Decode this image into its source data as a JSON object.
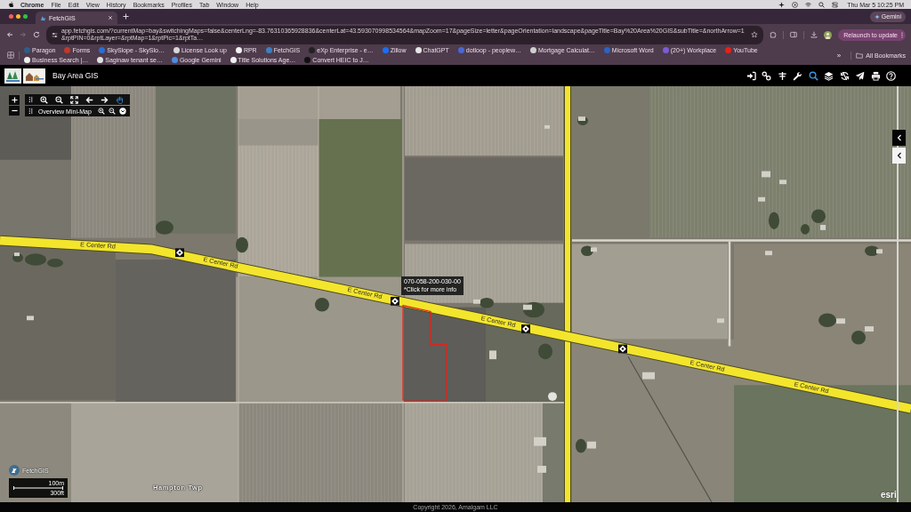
{
  "menu_bar": {
    "app": "Chrome",
    "menus": [
      "File",
      "Edit",
      "View",
      "History",
      "Bookmarks",
      "Profiles",
      "Tab",
      "Window",
      "Help"
    ],
    "clock": "Thu Mar 5 10:25 PM"
  },
  "browser": {
    "tabs": [
      {
        "title": "FetchGIS",
        "selected": true
      }
    ],
    "gemini_button": "Gemini",
    "nav": [
      {
        "kind": "back",
        "disabled": false
      },
      {
        "kind": "forward",
        "disabled": true
      },
      {
        "kind": "reload",
        "disabled": false
      }
    ],
    "url": "app.fetchgis.com/?currentMap=bay&switchingMaps=false&centerLng=-83.76310365928836&centerLat=43.593070998534564&mapZoom=17&pageSize=letter&pageOrientation=landscape&pageTitle=Bay%20Area%20GIS&subTitle=&northArrow=1&rptPIN=0&rptLayer=&rptMap=1&rptPic=1&rptTa…",
    "relaunch_button": "Relaunch to update",
    "bookmarks": [
      {
        "label": "Paragon",
        "color": "#2f5d8a"
      },
      {
        "label": "Forms",
        "color": "#c0392b"
      },
      {
        "label": "SkySlope - SkySlo…",
        "color": "#2a6fd1"
      },
      {
        "label": "License Look up",
        "color": "#d8d8d8"
      },
      {
        "label": "RPR",
        "color": "#f2f2f2"
      },
      {
        "label": "FetchGIS",
        "color": "#3d7fc1"
      },
      {
        "label": "eXp Enterprise - e…",
        "color": "#222222"
      },
      {
        "label": "Zillow",
        "color": "#1a6ff0"
      },
      {
        "label": "ChatGPT",
        "color": "#e6e6e6"
      },
      {
        "label": "dotloop - peoplew…",
        "color": "#4a67d6"
      },
      {
        "label": "Mortgage Calculat…",
        "color": "#cfcfcf"
      },
      {
        "label": "Microsoft Word",
        "color": "#2b63c7"
      },
      {
        "label": "(20+) Workplace",
        "color": "#7b5cd6"
      },
      {
        "label": "YouTube",
        "color": "#e62117"
      },
      {
        "label": "Business Search |…",
        "color": "#eeeeee"
      },
      {
        "label": "Saginaw tenant se…",
        "color": "#e0e0e0"
      },
      {
        "label": "Google Gemini",
        "color": "#4f8be0"
      },
      {
        "label": "Title Solutions Age…",
        "color": "#f0f0f0"
      },
      {
        "label": "Convert HEIC to J…",
        "color": "#111111"
      }
    ],
    "more_bookmarks": "»",
    "all_bookmarks": "All Bookmarks"
  },
  "app_header": {
    "title": "Bay Area GIS",
    "tools": [
      {
        "kind": "sign-in",
        "selected": false
      },
      {
        "kind": "link",
        "selected": false
      },
      {
        "kind": "pole",
        "selected": false
      },
      {
        "kind": "wrench",
        "selected": false
      },
      {
        "kind": "search",
        "selected": true
      },
      {
        "kind": "layers",
        "selected": false
      },
      {
        "kind": "sync",
        "selected": false
      },
      {
        "kind": "send",
        "selected": false
      },
      {
        "kind": "print",
        "selected": false
      },
      {
        "kind": "help",
        "selected": false
      }
    ]
  },
  "map": {
    "toolbar": {
      "tools": [
        {
          "kind": "zoom-in",
          "selected": false
        },
        {
          "kind": "zoom-out",
          "selected": false
        },
        {
          "kind": "full-extent",
          "selected": false
        },
        {
          "kind": "back",
          "selected": false
        },
        {
          "kind": "forward",
          "selected": false
        },
        {
          "kind": "pan",
          "selected": true
        }
      ]
    },
    "minimap": {
      "label": "Overview Mini-Map"
    },
    "road_labels": [
      "E Center Rd",
      "E Center Rd",
      "E Center Rd",
      "E Center Rd",
      "E Center Rd",
      "E Center Rd"
    ],
    "area_label": "Hampton Twp",
    "popup": {
      "parcel_id": "070-058-200-030-00",
      "hint": "*Click for more info"
    },
    "scale": {
      "metric": "100m",
      "imperial": "300ft"
    },
    "logo_text": "FetchGIS",
    "attribution": "esri"
  },
  "footer": {
    "copyright": "Copyright 2026, Amalgam LLC"
  }
}
